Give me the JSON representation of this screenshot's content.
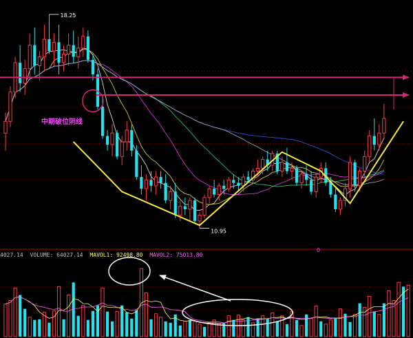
{
  "colors": {
    "background": "#000000",
    "up": "#ff3b4a",
    "down": "#27e1ec",
    "annotation_arrow": "#d6257a",
    "annotation_text": "#ff40ff",
    "zigzag": "#f5ec44",
    "ma_short": "#ffffff",
    "ma_mid": "#f5ec44",
    "ma_long1": "#ff3bff",
    "ma_long2": "#32e27a",
    "ma_long3": "#3e55ff",
    "ma_long4": "#b8b8b8",
    "grid": "#b10000",
    "vol_header_gray": "#c0c0c0",
    "vol_header_volume": "#c0c0c0",
    "vol_header_mavol1": "#ffff66",
    "vol_header_mavol2": "#ff66ff"
  },
  "annotations": {
    "high_price_label": "18.25",
    "low_price_label": "10.95",
    "breakdown_label": "中期破位阴线",
    "mid_marker": "0"
  },
  "volume_header": {
    "left_value": "4027.14",
    "volume_label": "VOLUME: 64027.14",
    "mavol1_label": "MAVOL1: 92498.80",
    "mavol2_label": "MAVOL2: 75013.80"
  },
  "chart_data": {
    "type": "candlestick",
    "title": "",
    "price_annotations": {
      "high": 18.25,
      "low": 10.95
    },
    "candles": [
      {
        "o": 14.2,
        "h": 14.9,
        "l": 13.6,
        "c": 14.6
      },
      {
        "o": 14.6,
        "h": 15.8,
        "l": 14.4,
        "c": 15.6
      },
      {
        "o": 15.6,
        "h": 16.8,
        "l": 15.4,
        "c": 16.6
      },
      {
        "o": 16.6,
        "h": 17.2,
        "l": 15.6,
        "c": 15.9
      },
      {
        "o": 15.9,
        "h": 16.7,
        "l": 15.5,
        "c": 16.4
      },
      {
        "o": 16.4,
        "h": 17.6,
        "l": 16.1,
        "c": 17.2
      },
      {
        "o": 17.2,
        "h": 17.8,
        "l": 16.2,
        "c": 16.5
      },
      {
        "o": 16.5,
        "h": 17.0,
        "l": 16.0,
        "c": 16.8
      },
      {
        "o": 16.8,
        "h": 17.9,
        "l": 16.3,
        "c": 17.4
      },
      {
        "o": 17.4,
        "h": 18.25,
        "l": 16.9,
        "c": 17.0
      },
      {
        "o": 17.0,
        "h": 17.6,
        "l": 16.5,
        "c": 17.3
      },
      {
        "o": 17.3,
        "h": 17.9,
        "l": 16.2,
        "c": 16.6
      },
      {
        "o": 16.6,
        "h": 17.2,
        "l": 16.3,
        "c": 16.9
      },
      {
        "o": 16.9,
        "h": 17.6,
        "l": 16.5,
        "c": 17.2
      },
      {
        "o": 17.2,
        "h": 17.7,
        "l": 16.6,
        "c": 16.8
      },
      {
        "o": 16.8,
        "h": 17.5,
        "l": 16.4,
        "c": 17.1
      },
      {
        "o": 17.1,
        "h": 17.8,
        "l": 16.8,
        "c": 17.5
      },
      {
        "o": 17.5,
        "h": 17.7,
        "l": 16.6,
        "c": 16.7
      },
      {
        "o": 16.7,
        "h": 16.9,
        "l": 16.0,
        "c": 16.2
      },
      {
        "o": 16.2,
        "h": 16.4,
        "l": 15.0,
        "c": 15.1
      },
      {
        "o": 15.1,
        "h": 15.4,
        "l": 14.0,
        "c": 14.1
      },
      {
        "o": 14.1,
        "h": 14.3,
        "l": 13.6,
        "c": 13.8
      },
      {
        "o": 13.8,
        "h": 14.5,
        "l": 13.4,
        "c": 14.2
      },
      {
        "o": 14.2,
        "h": 14.3,
        "l": 13.3,
        "c": 13.4
      },
      {
        "o": 13.4,
        "h": 14.1,
        "l": 13.1,
        "c": 13.9
      },
      {
        "o": 13.9,
        "h": 14.6,
        "l": 13.6,
        "c": 14.3
      },
      {
        "o": 14.3,
        "h": 14.5,
        "l": 13.4,
        "c": 13.6
      },
      {
        "o": 13.6,
        "h": 13.8,
        "l": 12.6,
        "c": 12.7
      },
      {
        "o": 12.7,
        "h": 13.1,
        "l": 12.1,
        "c": 12.3
      },
      {
        "o": 12.3,
        "h": 12.8,
        "l": 11.9,
        "c": 12.6
      },
      {
        "o": 12.6,
        "h": 12.9,
        "l": 12.2,
        "c": 12.4
      },
      {
        "o": 12.4,
        "h": 12.9,
        "l": 12.1,
        "c": 12.7
      },
      {
        "o": 12.7,
        "h": 12.9,
        "l": 12.3,
        "c": 12.5
      },
      {
        "o": 12.5,
        "h": 12.8,
        "l": 11.8,
        "c": 11.9
      },
      {
        "o": 11.9,
        "h": 12.4,
        "l": 11.6,
        "c": 12.2
      },
      {
        "o": 12.2,
        "h": 12.5,
        "l": 11.3,
        "c": 11.4
      },
      {
        "o": 11.4,
        "h": 11.9,
        "l": 11.2,
        "c": 11.7
      },
      {
        "o": 11.7,
        "h": 12.0,
        "l": 11.4,
        "c": 11.6
      },
      {
        "o": 11.6,
        "h": 12.0,
        "l": 11.2,
        "c": 11.9
      },
      {
        "o": 11.9,
        "h": 12.0,
        "l": 11.1,
        "c": 11.2
      },
      {
        "o": 11.2,
        "h": 11.5,
        "l": 10.95,
        "c": 11.4
      },
      {
        "o": 11.4,
        "h": 12.1,
        "l": 11.3,
        "c": 12.0
      },
      {
        "o": 12.0,
        "h": 12.4,
        "l": 11.8,
        "c": 12.3
      },
      {
        "o": 12.3,
        "h": 12.6,
        "l": 12.0,
        "c": 12.1
      },
      {
        "o": 12.1,
        "h": 12.5,
        "l": 11.9,
        "c": 12.4
      },
      {
        "o": 12.4,
        "h": 12.6,
        "l": 12.1,
        "c": 12.3
      },
      {
        "o": 12.3,
        "h": 12.7,
        "l": 12.2,
        "c": 12.6
      },
      {
        "o": 12.6,
        "h": 12.8,
        "l": 12.3,
        "c": 12.5
      },
      {
        "o": 12.5,
        "h": 12.7,
        "l": 12.2,
        "c": 12.4
      },
      {
        "o": 12.4,
        "h": 12.8,
        "l": 12.2,
        "c": 12.7
      },
      {
        "o": 12.7,
        "h": 12.9,
        "l": 12.5,
        "c": 12.6
      },
      {
        "o": 12.6,
        "h": 13.0,
        "l": 12.5,
        "c": 12.9
      },
      {
        "o": 12.9,
        "h": 13.3,
        "l": 12.7,
        "c": 13.0
      },
      {
        "o": 13.0,
        "h": 13.4,
        "l": 12.8,
        "c": 13.3
      },
      {
        "o": 13.3,
        "h": 13.6,
        "l": 12.9,
        "c": 13.1
      },
      {
        "o": 13.1,
        "h": 13.6,
        "l": 12.9,
        "c": 13.5
      },
      {
        "o": 13.5,
        "h": 13.6,
        "l": 12.8,
        "c": 12.9
      },
      {
        "o": 12.9,
        "h": 13.4,
        "l": 12.7,
        "c": 13.2
      },
      {
        "o": 13.2,
        "h": 13.7,
        "l": 12.8,
        "c": 12.9
      },
      {
        "o": 12.9,
        "h": 13.2,
        "l": 12.6,
        "c": 13.0
      },
      {
        "o": 13.0,
        "h": 13.1,
        "l": 12.4,
        "c": 12.5
      },
      {
        "o": 12.5,
        "h": 12.9,
        "l": 12.3,
        "c": 12.8
      },
      {
        "o": 12.8,
        "h": 13.1,
        "l": 12.4,
        "c": 12.6
      },
      {
        "o": 12.6,
        "h": 12.9,
        "l": 12.1,
        "c": 12.2
      },
      {
        "o": 12.2,
        "h": 12.8,
        "l": 12.0,
        "c": 12.7
      },
      {
        "o": 12.7,
        "h": 13.2,
        "l": 12.5,
        "c": 13.0
      },
      {
        "o": 13.0,
        "h": 13.2,
        "l": 12.4,
        "c": 12.5
      },
      {
        "o": 12.5,
        "h": 12.7,
        "l": 12.0,
        "c": 12.1
      },
      {
        "o": 12.1,
        "h": 12.3,
        "l": 11.5,
        "c": 11.6
      },
      {
        "o": 11.6,
        "h": 12.0,
        "l": 11.4,
        "c": 11.9
      },
      {
        "o": 11.9,
        "h": 12.5,
        "l": 11.7,
        "c": 12.3
      },
      {
        "o": 12.3,
        "h": 13.4,
        "l": 12.0,
        "c": 13.2
      },
      {
        "o": 13.2,
        "h": 13.3,
        "l": 12.2,
        "c": 12.4
      },
      {
        "o": 12.4,
        "h": 13.0,
        "l": 12.2,
        "c": 12.9
      },
      {
        "o": 12.9,
        "h": 13.6,
        "l": 12.7,
        "c": 13.4
      },
      {
        "o": 13.4,
        "h": 14.3,
        "l": 13.2,
        "c": 14.1
      },
      {
        "o": 14.1,
        "h": 14.7,
        "l": 13.6,
        "c": 13.8
      },
      {
        "o": 13.8,
        "h": 14.5,
        "l": 13.6,
        "c": 14.2
      },
      {
        "o": 14.2,
        "h": 15.2,
        "l": 14.0,
        "c": 14.7
      }
    ],
    "zigzag": [
      {
        "i": 14,
        "p": 13.9
      },
      {
        "i": 24,
        "p": 12.2
      },
      {
        "i": 40,
        "p": 11.05
      },
      {
        "i": 57,
        "p": 13.55
      },
      {
        "i": 65,
        "p": 12.9
      },
      {
        "i": 71,
        "p": 11.8
      },
      {
        "i": 82,
        "p": 14.6
      }
    ],
    "horizontal_levels": [
      16.1,
      15.5
    ],
    "volume": [
      47000,
      52000,
      70000,
      60000,
      40000,
      28000,
      24000,
      25000,
      35000,
      20000,
      37000,
      72000,
      25000,
      60000,
      78000,
      30000,
      45000,
      24000,
      37000,
      45000,
      70000,
      36000,
      22000,
      36000,
      45000,
      35000,
      26000,
      38000,
      98000,
      63000,
      25000,
      33000,
      28000,
      22000,
      20000,
      32000,
      16000,
      22000,
      24000,
      22000,
      18000,
      14000,
      20000,
      24000,
      19000,
      19000,
      30000,
      24000,
      31000,
      24000,
      28000,
      20000,
      26000,
      30000,
      26000,
      34000,
      22000,
      30000,
      18000,
      36000,
      24000,
      16000,
      32000,
      26000,
      44000,
      22000,
      18000,
      24000,
      27000,
      40000,
      33000,
      21000,
      32000,
      48000,
      42000,
      58000,
      36000,
      32000,
      48000,
      66000,
      52000,
      78000,
      72000,
      74000
    ],
    "volume_up": [
      true,
      true,
      true,
      false,
      false,
      true,
      false,
      false,
      true,
      false,
      true,
      true,
      false,
      true,
      false,
      false,
      true,
      false,
      false,
      false,
      true,
      false,
      false,
      true,
      false,
      false,
      false,
      false,
      true,
      true,
      false,
      true,
      true,
      false,
      false,
      false,
      false,
      true,
      false,
      true,
      true,
      false,
      true,
      true,
      true,
      false,
      true,
      false,
      true,
      true,
      false,
      true,
      false,
      true,
      false,
      true,
      false,
      true,
      false,
      true,
      false,
      true,
      false,
      true,
      true,
      false,
      true,
      true,
      false,
      true,
      false,
      false,
      true,
      false,
      true,
      true,
      false,
      true,
      false,
      true,
      true,
      true,
      false,
      true
    ],
    "ma_volume": {
      "mavol1": 92498.8,
      "mavol2": 75013.8
    }
  }
}
